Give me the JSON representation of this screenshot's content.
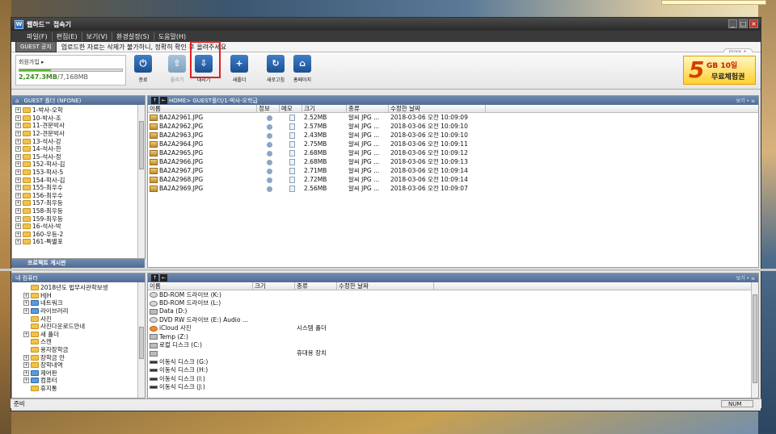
{
  "window": {
    "title": "웹하드™ 접속기"
  },
  "menu": [
    "파일(F)",
    "편집(E)",
    "보기(V)",
    "환경설정(S)",
    "도움말(H)"
  ],
  "notice": {
    "badge": "GUEST 공지",
    "text": "업로드한 자료는 삭제가 불가하니, 정확히 확인 후 올려주세요",
    "more": "more +"
  },
  "account": {
    "join": "회원가입 ▸",
    "used": "2,247.3MB",
    "total": "/7,168MB",
    "usage_fraction": 0.31
  },
  "toolbar": [
    {
      "label": "종료",
      "icon": "power-icon",
      "glyph": "⏻",
      "disabled": false
    },
    {
      "label": "올리기",
      "icon": "upload-arrow-icon",
      "glyph": "⇧",
      "disabled": true
    },
    {
      "label": "내리기",
      "icon": "download-arrow-icon",
      "glyph": "⇩",
      "disabled": false
    },
    {
      "label": "새폴더",
      "icon": "new-folder-icon",
      "glyph": "+",
      "disabled": false
    },
    {
      "label": "새로고침",
      "icon": "refresh-icon",
      "glyph": "↻",
      "disabled": false
    },
    {
      "label": "홈페이지",
      "icon": "home-icon",
      "glyph": "⌂",
      "disabled": false
    }
  ],
  "promo": {
    "num": "5",
    "gb": "GB 10일",
    "sub": "무료체험권"
  },
  "remote_tree": {
    "header": "GUEST 폴더 (NFONE)",
    "items": [
      "1-박사-오학",
      "10-박사-조",
      "11-견문박사",
      "12-견문박사",
      "13-석사-강",
      "14-석사-한",
      "15-석사-정",
      "152-학사-김",
      "153-학사-5",
      "154-학사-김",
      "155-최우수",
      "156-최우수",
      "157-최우등",
      "158-최우등",
      "159-최우등",
      "16-석사-박",
      "160-우등-2",
      "161-특별포"
    ],
    "project": "프로젝트 게시판"
  },
  "remote_list": {
    "path": "HOME> GUEST폴더/1-박사-오학급",
    "view": "보기 • ≡",
    "columns": [
      "이름",
      "정보",
      "메모",
      "크기",
      "종류",
      "수정한 날짜"
    ],
    "rows": [
      {
        "name": "BA2A2961.JPG",
        "size": "2.52MB",
        "type": "알씨 JPG ...",
        "date": "2018-03-06 오전 10:09:09"
      },
      {
        "name": "BA2A2962.JPG",
        "size": "2.57MB",
        "type": "알씨 JPG ...",
        "date": "2018-03-06 오전 10:09:10"
      },
      {
        "name": "BA2A2963.JPG",
        "size": "2.43MB",
        "type": "알씨 JPG ...",
        "date": "2018-03-06 오전 10:09:10"
      },
      {
        "name": "BA2A2964.JPG",
        "size": "2.75MB",
        "type": "알씨 JPG ...",
        "date": "2018-03-06 오전 10:09:11"
      },
      {
        "name": "BA2A2965.JPG",
        "size": "2.68MB",
        "type": "알씨 JPG ...",
        "date": "2018-03-06 오전 10:09:12"
      },
      {
        "name": "BA2A2966.JPG",
        "size": "2.68MB",
        "type": "알씨 JPG ...",
        "date": "2018-03-06 오전 10:09:13"
      },
      {
        "name": "BA2A2967.JPG",
        "size": "2.71MB",
        "type": "알씨 JPG ...",
        "date": "2018-03-06 오전 10:09:14"
      },
      {
        "name": "BA2A2968.JPG",
        "size": "2.72MB",
        "type": "알씨 JPG ...",
        "date": "2018-03-06 오전 10:09:14"
      },
      {
        "name": "BA2A2969.JPG",
        "size": "2.56MB",
        "type": "알씨 JPG ...",
        "date": "2018-03-06 오전 10:09:07"
      }
    ]
  },
  "local_tree": {
    "header": "내 컴퓨터",
    "items": [
      "2018년도 법무사관학보생",
      "HJH",
      "네트워크",
      "라이브러리",
      "사진",
      "사진다운로드안내",
      "새 폴더",
      "스캔",
      "용자장학금",
      "장학금 안",
      "장학내역",
      "제어판",
      "컴퓨터",
      "휴지통"
    ]
  },
  "local_list": {
    "view": "보기 • ≡",
    "columns": [
      "이름",
      "크기",
      "종류",
      "수정한 날짜"
    ],
    "rows": [
      {
        "name": "BD-ROM 드라이브 (K:)",
        "type": "",
        "icon": "cd"
      },
      {
        "name": "BD-ROM 드라이브 (L:)",
        "type": "",
        "icon": "cd"
      },
      {
        "name": "Data (D:)",
        "type": "",
        "icon": "hd"
      },
      {
        "name": "DVD RW 드라이브 (E:) Audio ...",
        "type": "",
        "icon": "cd"
      },
      {
        "name": "iCloud 사진",
        "type": "시스템 폴더",
        "icon": "cloud"
      },
      {
        "name": "Temp (Z:)",
        "type": "",
        "icon": "hd"
      },
      {
        "name": "로컬 디스크 (C:)",
        "type": "",
        "icon": "hd"
      },
      {
        "name": "",
        "type": "휴대용 장치",
        "icon": "hd"
      },
      {
        "name": "이동식 디스크 (G:)",
        "type": "",
        "icon": "dark"
      },
      {
        "name": "이동식 디스크 (H:)",
        "type": "",
        "icon": "dark"
      },
      {
        "name": "이동식 디스크 (I:)",
        "type": "",
        "icon": "dark"
      },
      {
        "name": "이동식 디스크 (J:)",
        "type": "",
        "icon": "dark"
      }
    ]
  },
  "status": {
    "left": "준비",
    "num": "NUM"
  }
}
